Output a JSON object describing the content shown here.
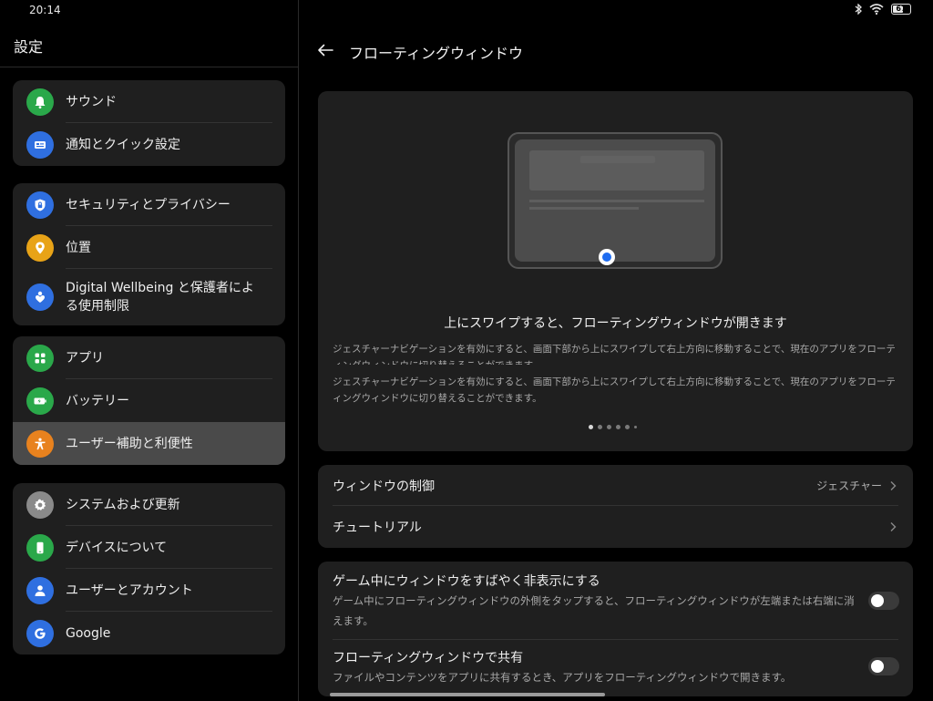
{
  "status_bar": {
    "time": "20:14",
    "battery_level": "67",
    "battery_fraction": 0.67,
    "icons": [
      "bluetooth-icon",
      "wifi-icon",
      "battery-icon"
    ]
  },
  "sidebar": {
    "title": "設定",
    "groups": [
      {
        "items": [
          {
            "label": "サウンド",
            "icon": "bell-icon",
            "color": "#2aa84a"
          },
          {
            "label": "通知とクイック設定",
            "icon": "notification-card-icon",
            "color": "#2f6fe0"
          }
        ]
      },
      {
        "items": [
          {
            "label": "セキュリティとプライバシー",
            "icon": "shield-lock-icon",
            "color": "#2f6fe0"
          },
          {
            "label": "位置",
            "icon": "location-pin-icon",
            "color": "#e8a317"
          },
          {
            "label": "Digital Wellbeing と保護者による使用制限",
            "icon": "heart-person-icon",
            "color": "#2f6fe0"
          }
        ]
      },
      {
        "items": [
          {
            "label": "アプリ",
            "icon": "apps-grid-icon",
            "color": "#2aa84a"
          },
          {
            "label": "バッテリー",
            "icon": "battery-icon",
            "color": "#2aa84a"
          },
          {
            "label": "ユーザー補助と利便性",
            "icon": "accessibility-icon",
            "color": "#e8821e",
            "selected": true
          }
        ]
      },
      {
        "items": [
          {
            "label": "システムおよび更新",
            "icon": "gear-icon",
            "color": "#8a8a8a"
          },
          {
            "label": "デバイスについて",
            "icon": "phone-icon",
            "color": "#2aa84a"
          },
          {
            "label": "ユーザーとアカウント",
            "icon": "user-icon",
            "color": "#2f6fe0"
          },
          {
            "label": "Google",
            "icon": "google-icon",
            "color": "#2f6fe0"
          }
        ]
      }
    ]
  },
  "header": {
    "back_icon": "back-arrow-icon",
    "title": "フローティングウィンドウ"
  },
  "hero": {
    "title": "上にスワイプすると、フローティングウィンドウが開きます",
    "description_partial": "ジェスチャーナビゲーションを有効にすると、画面下部から上にスワイプして右上方向に移動することで、現在のアプリをフローティングウィンドウに切り替えることができます。",
    "description": "ジェスチャーナビゲーションを有効にすると、画面下部から上にスワイプして右上方向に移動することで、現在のアプリをフローティングウィンドウに切り替えることができます。",
    "pages": 6,
    "active_page": 0
  },
  "settings": {
    "window_control": {
      "label": "ウィンドウの制御",
      "value": "ジェスチャー"
    },
    "tutorial": {
      "label": "チュートリアル"
    }
  },
  "toggles": [
    {
      "label": "ゲーム中にウィンドウをすばやく非表示にする",
      "description": "ゲーム中にフローティングウィンドウの外側をタップすると、フローティングウィンドウが左端または右端に消えます。",
      "on": false
    },
    {
      "label": "フローティングウィンドウで共有",
      "description": "ファイルやコンテンツをアプリに共有するとき、アプリをフローティングウィンドウで開きます。",
      "on": false
    }
  ]
}
